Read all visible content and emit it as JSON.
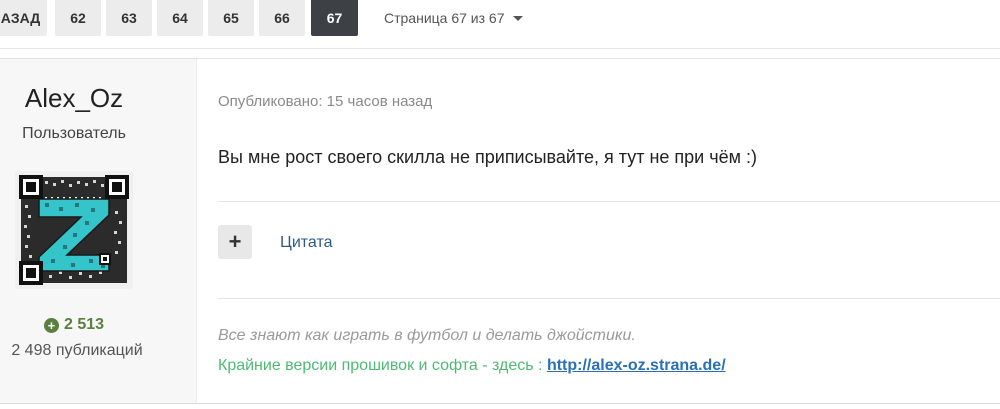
{
  "pagination": {
    "back_label": "АЗАД",
    "pages": [
      "62",
      "63",
      "64",
      "65",
      "66",
      "67"
    ],
    "active_page": "67",
    "info_text": "Страница 67 из 67"
  },
  "post": {
    "author": {
      "name": "Alex_Oz",
      "role": "Пользователь",
      "reputation_icon": "plus-circle-icon",
      "reputation": "2 513",
      "publications": "2 498 публикаций"
    },
    "published": "Опубликовано: 15 часов назад",
    "text": "Вы мне рост своего скилла не приписывайте, я тут не при чём :)",
    "quote_button_symbol": "+",
    "quote_label": "Цитата",
    "signature": {
      "line1": "Все знают как играть в футбол и делать джойстики.",
      "line2_text": "Крайние версии прошивок и софта - здесь : ",
      "line2_link": "http://alex-oz.strana.de/"
    }
  },
  "colors": {
    "active_page_bg": "#3d4045",
    "reputation_green": "#5b7f3d",
    "signature_green": "#4dbb73",
    "link_blue": "#2a6fb7",
    "quote_link": "#2e5a87"
  }
}
